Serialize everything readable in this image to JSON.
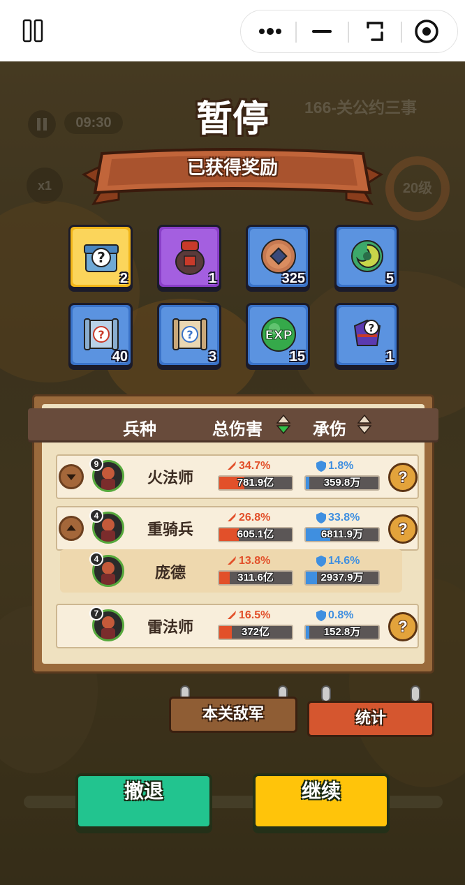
{
  "title": "暂停",
  "banner": "已获得奖励",
  "background": {
    "timer": "09:30",
    "stage": "166-关公约三事",
    "speed": "x1",
    "level": "20级"
  },
  "rewards": [
    {
      "icon": "mystery-chest-icon",
      "count": "2",
      "frame": "gold"
    },
    {
      "icon": "wine-jar-icon",
      "count": "1",
      "frame": "purple"
    },
    {
      "icon": "copper-coin-icon",
      "count": "325",
      "frame": "blue"
    },
    {
      "icon": "jade-pendant-icon",
      "count": "5",
      "frame": "blue"
    },
    {
      "icon": "blue-scroll-icon",
      "count": "40",
      "frame": "blue"
    },
    {
      "icon": "tan-scroll-icon",
      "count": "3",
      "frame": "blue"
    },
    {
      "icon": "exp-orb-icon",
      "count": "15",
      "frame": "blue"
    },
    {
      "icon": "mystery-armor-icon",
      "count": "1",
      "frame": "blue"
    }
  ],
  "table": {
    "headers": {
      "unit": "兵种",
      "damage": "总伤害",
      "taken": "承伤"
    },
    "rows": [
      {
        "level": "9",
        "name": "火法师",
        "dmg_pct": "34.7%",
        "dmg_value": "781.9亿",
        "dmg_fill": 0.35,
        "tank_pct": "1.8%",
        "tank_value": "359.8万",
        "tank_fill": 0.02,
        "toggle": "down"
      },
      {
        "level": "4",
        "name": "重骑兵",
        "dmg_pct": "26.8%",
        "dmg_value": "605.1亿",
        "dmg_fill": 0.27,
        "tank_pct": "33.8%",
        "tank_value": "6811.9万",
        "tank_fill": 0.34,
        "toggle": "up"
      },
      {
        "level": "4",
        "name": "庞德",
        "dmg_pct": "13.8%",
        "dmg_value": "311.6亿",
        "dmg_fill": 0.14,
        "tank_pct": "14.6%",
        "tank_value": "2937.9万",
        "tank_fill": 0.15,
        "sub": true
      },
      {
        "level": "7",
        "name": "雷法师",
        "dmg_pct": "16.5%",
        "dmg_value": "372亿",
        "dmg_fill": 0.17,
        "tank_pct": "0.8%",
        "tank_value": "152.8万",
        "tank_fill": 0.01
      }
    ]
  },
  "signs": {
    "enemies": "本关敌军",
    "stats": "统计"
  },
  "buttons": {
    "retreat": "撤退",
    "continue": "继续"
  },
  "help_label": "?",
  "colors": {
    "damage": "#e2502a",
    "taken": "#3f8fe0",
    "retreat": "#22c48f",
    "continue": "#ffc40a"
  }
}
